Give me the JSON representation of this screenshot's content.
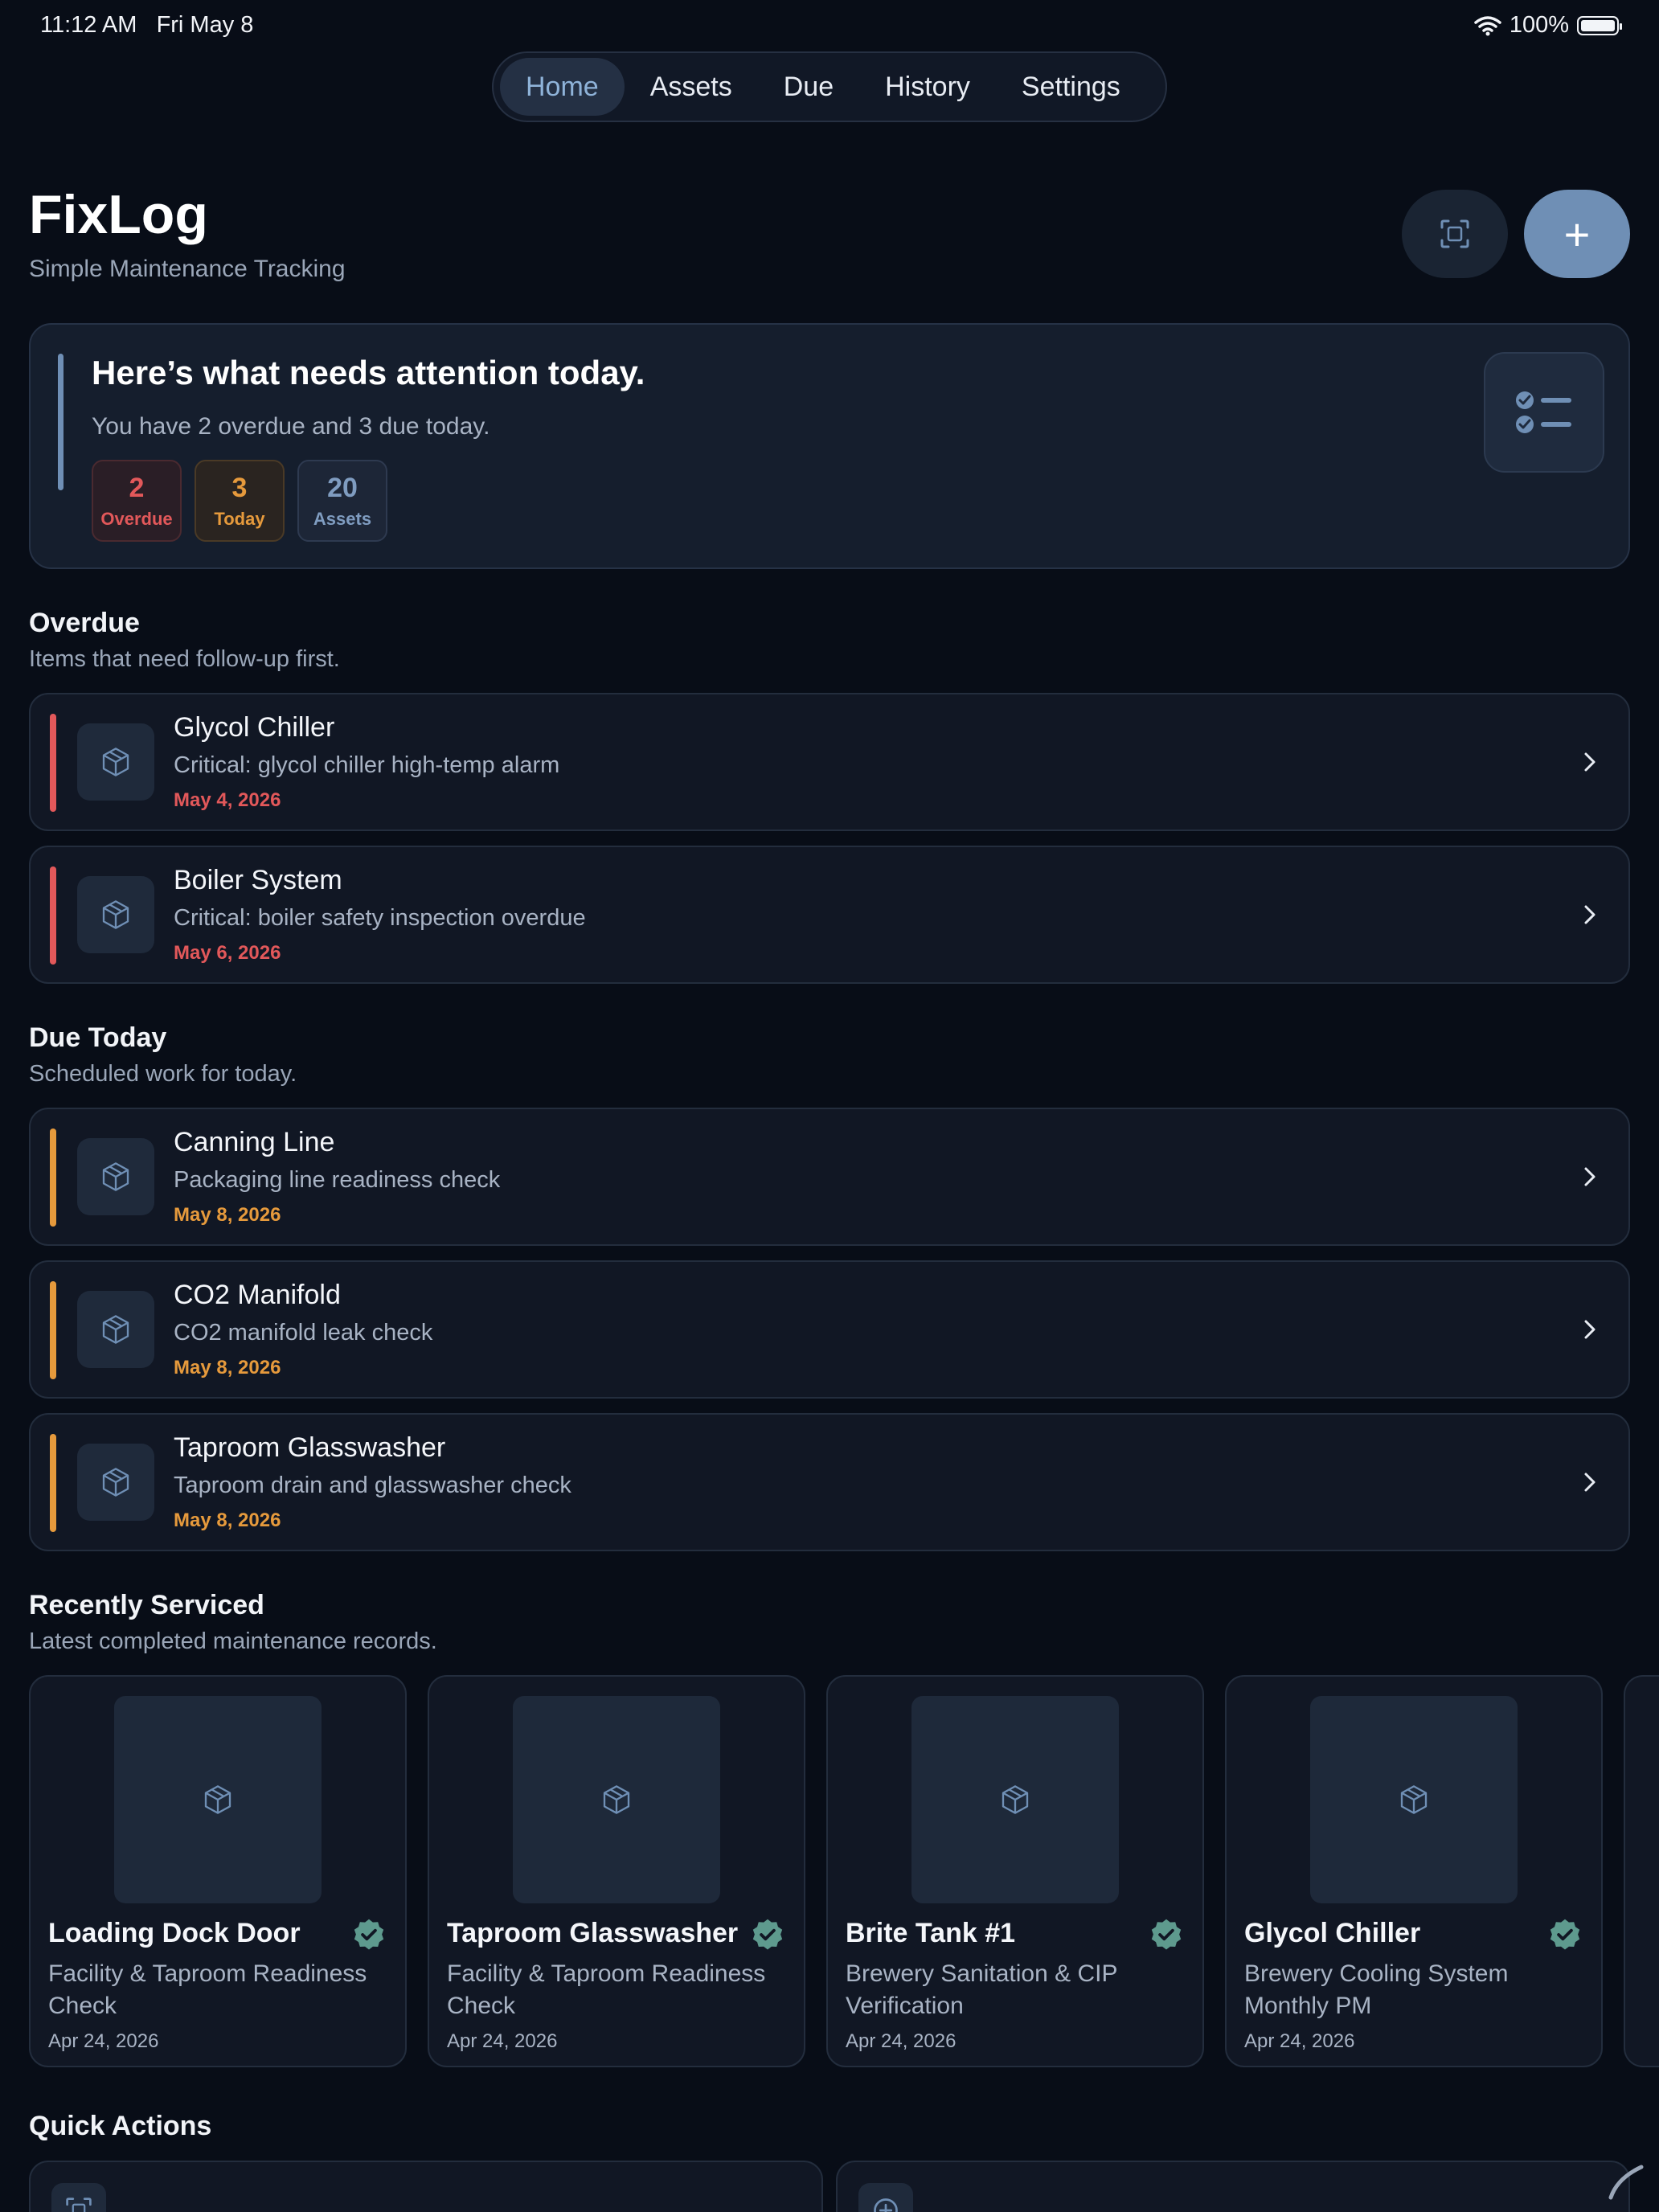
{
  "status": {
    "time": "11:12 AM",
    "date": "Fri May 8",
    "battery": "100%",
    "icons": [
      "wifi-icon",
      "battery-icon"
    ]
  },
  "tabs": [
    {
      "label": "Home",
      "active": true
    },
    {
      "label": "Assets",
      "active": false
    },
    {
      "label": "Due",
      "active": false
    },
    {
      "label": "History",
      "active": false
    },
    {
      "label": "Settings",
      "active": false
    }
  ],
  "header": {
    "title": "FixLog",
    "subtitle": "Simple Maintenance Tracking",
    "actions": [
      "scan-icon",
      "plus-icon"
    ],
    "add_label": "+"
  },
  "summary": {
    "heading": "Here’s what needs attention today.",
    "subtitle": "You have 2 overdue and 3 due today.",
    "chips": [
      {
        "value": "2",
        "label": "Overdue"
      },
      {
        "value": "3",
        "label": "Today"
      },
      {
        "value": "20",
        "label": "Assets"
      }
    ],
    "icon": "checklist-icon"
  },
  "overdue": {
    "title": "Overdue",
    "subtitle": "Items that need follow-up first.",
    "items": [
      {
        "name": "Glycol Chiller",
        "description": "Critical: glycol chiller high-temp alarm",
        "date": "May 4, 2026"
      },
      {
        "name": "Boiler System",
        "description": "Critical: boiler safety inspection overdue",
        "date": "May 6, 2026"
      }
    ]
  },
  "due_today": {
    "title": "Due Today",
    "subtitle": "Scheduled work for today.",
    "items": [
      {
        "name": "Canning Line",
        "description": "Packaging line readiness check",
        "date": "May 8, 2026"
      },
      {
        "name": "CO2 Manifold",
        "description": "CO2 manifold leak check",
        "date": "May 8, 2026"
      },
      {
        "name": "Taproom Glasswasher",
        "description": "Taproom drain and glasswasher check",
        "date": "May 8, 2026"
      }
    ]
  },
  "recent": {
    "title": "Recently Serviced",
    "subtitle": "Latest completed maintenance records.",
    "items": [
      {
        "name": "Loading Dock Door",
        "description": "Facility & Taproom Readiness Check",
        "date": "Apr 24, 2026"
      },
      {
        "name": "Taproom Glasswasher",
        "description": "Facility & Taproom Readiness Check",
        "date": "Apr 24, 2026"
      },
      {
        "name": "Brite Tank #1",
        "description": "Brewery Sanitation & CIP Verification",
        "date": "Apr 24, 2026"
      },
      {
        "name": "Glycol Chiller",
        "description": "Brewery Cooling System Monthly PM",
        "date": "Apr 24, 2026"
      }
    ]
  },
  "quick_actions": {
    "title": "Quick Actions",
    "icons": [
      "scan-icon",
      "add-circle-icon"
    ]
  },
  "colors": {
    "accent": "#6f8fb5",
    "overdue": "#e2585a",
    "today": "#e69a3c",
    "verified": "#5e9a8e",
    "background": "#080d17"
  }
}
